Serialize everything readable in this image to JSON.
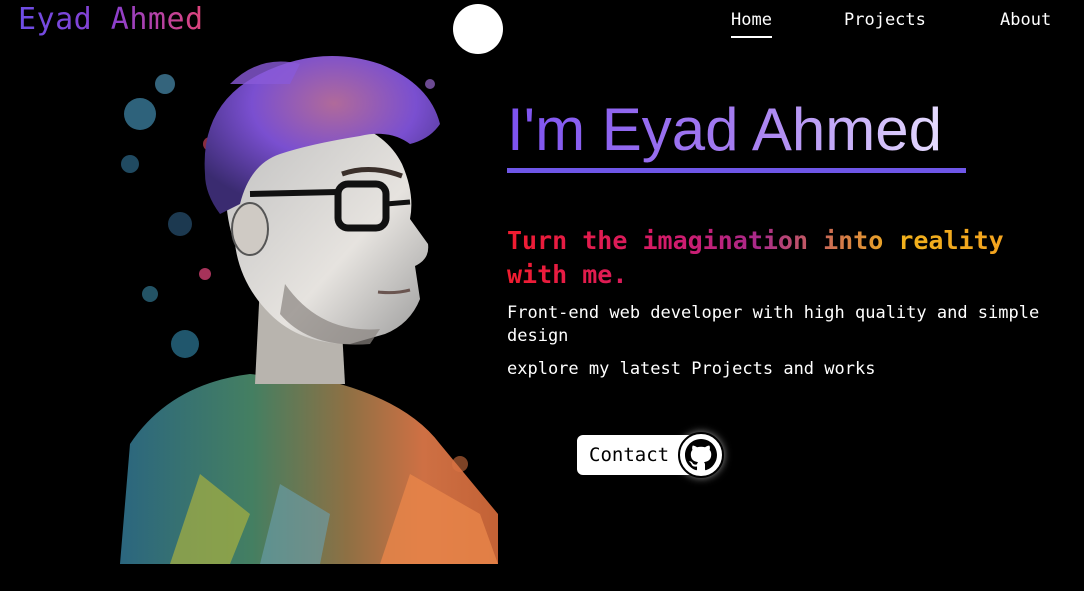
{
  "header": {
    "logo": "Eyad Ahmed",
    "nav": {
      "home": "Home",
      "projects": "Projects",
      "about": "About"
    }
  },
  "hero": {
    "heading": "I'm Eyad Ahmed",
    "tagline": "Turn the imagination into reality with me.",
    "description": "Front-end web developer with high quality and simple design",
    "sub_description": "explore my latest Projects and works",
    "contact_label": "Contact"
  },
  "icons": {
    "github": "github-icon",
    "theme_toggle": "theme-toggle"
  },
  "colors": {
    "background": "#000000",
    "accent_purple": "#7d52f0",
    "underline": "#6f57e8",
    "tagline_red": "#f11c2e",
    "tagline_orange": "#f49a21"
  }
}
